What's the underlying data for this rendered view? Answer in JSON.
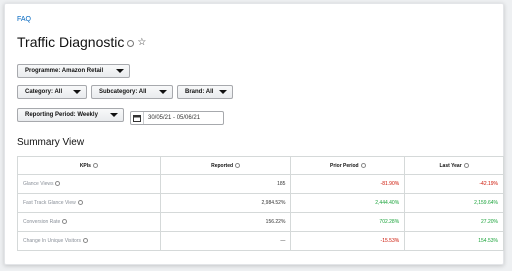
{
  "breadcrumb": "FAQ",
  "page": {
    "title": "Traffic Diagnostic"
  },
  "filters": {
    "programme": "Programme: Amazon Retail",
    "category": "Category: All",
    "subcategory": "Subcategory: All",
    "brand": "Brand: All",
    "reporting_period": "Reporting Period: Weekly",
    "date_range": "30/05/21 - 05/06/21"
  },
  "summary": {
    "title": "Summary View",
    "columns": [
      "KPIs",
      "Reported",
      "Prior Period",
      "Last Year"
    ],
    "rows": [
      {
        "kpi": "Glance Views",
        "reported": "185",
        "prior": "-81.90%",
        "last_year": "-42.19%",
        "prior_status": "neg",
        "ly_status": "neg"
      },
      {
        "kpi": "Fast Track Glance View",
        "reported": "2,984.52%",
        "prior": "2,444.40%",
        "last_year": "2,159.64%",
        "prior_status": "pos",
        "ly_status": "pos"
      },
      {
        "kpi": "Conversion Rate",
        "reported": "156.22%",
        "prior": "702.28%",
        "last_year": "27.20%",
        "prior_status": "pos",
        "ly_status": "pos"
      },
      {
        "kpi": "Change In Unique Visitors",
        "reported": "—",
        "prior": "-15.53%",
        "last_year": "154.53%",
        "prior_status": "neg",
        "ly_status": "pos"
      }
    ]
  },
  "colors": {
    "negative": "#cc1100",
    "positive": "#1aa33a",
    "link": "#0066c0"
  },
  "icons": [
    "info-icon",
    "star-icon",
    "caret-down-icon",
    "calendar-icon"
  ]
}
